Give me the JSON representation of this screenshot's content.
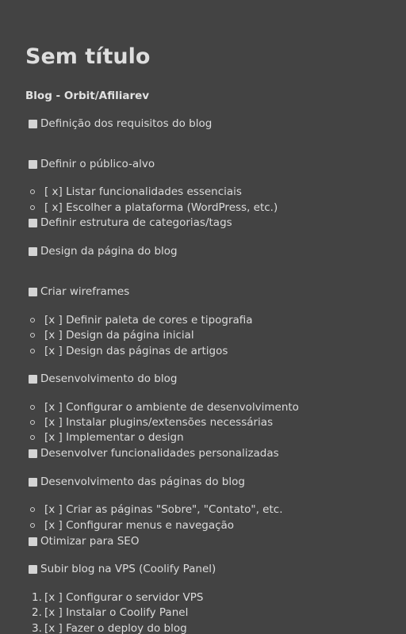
{
  "title": "Sem título",
  "subtitle": "Blog - Orbit/Afiliarev",
  "items": [
    {
      "kind": "task",
      "text": "Definição dos requisitos do blog"
    },
    {
      "kind": "task",
      "text": "Definir o público-alvo"
    },
    {
      "kind": "bullet",
      "text": "[ x] Listar funcionalidades essenciais"
    },
    {
      "kind": "bullet",
      "text": "[ x] Escolher a plataforma (WordPress, etc.)"
    },
    {
      "kind": "task",
      "text": "Definir estrutura de categorias/tags"
    },
    {
      "kind": "task",
      "text": "Design da página do blog"
    },
    {
      "kind": "task",
      "text": "Criar wireframes"
    },
    {
      "kind": "bullet",
      "text": "[x ] Definir paleta de cores e tipografia"
    },
    {
      "kind": "bullet",
      "text": "[x ] Design da página inicial"
    },
    {
      "kind": "bullet",
      "text": "[x ] Design das páginas de artigos"
    },
    {
      "kind": "task",
      "text": "Desenvolvimento do blog"
    },
    {
      "kind": "bullet",
      "text": "[x ] Configurar o ambiente de desenvolvimento"
    },
    {
      "kind": "bullet",
      "text": "[x ] Instalar plugins/extensões necessárias"
    },
    {
      "kind": "bullet",
      "text": "[x ] Implementar o design"
    },
    {
      "kind": "task",
      "text": "Desenvolver funcionalidades personalizadas"
    },
    {
      "kind": "task",
      "text": "Desenvolvimento das páginas do blog"
    },
    {
      "kind": "bullet",
      "text": "[x ] Criar as páginas \"Sobre\", \"Contato\", etc."
    },
    {
      "kind": "bullet",
      "text": "[x ] Configurar menus e navegação"
    },
    {
      "kind": "task",
      "text": "Otimizar para SEO"
    },
    {
      "kind": "task",
      "text": "Subir blog na VPS (Coolify Panel)"
    },
    {
      "kind": "numbered",
      "num": "1.",
      "text": "[x ] Configurar o servidor VPS"
    },
    {
      "kind": "numbered",
      "num": "2.",
      "text": "[x ] Instalar o Coolify Panel"
    },
    {
      "kind": "numbered",
      "num": "3.",
      "text": "[x ] Fazer o deploy do blog"
    }
  ]
}
